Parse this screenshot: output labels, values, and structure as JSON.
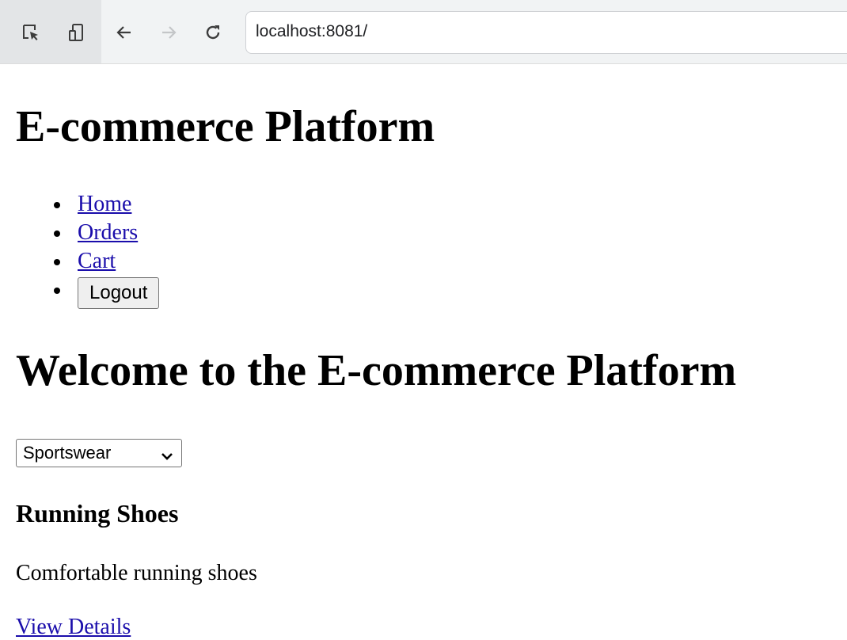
{
  "browser": {
    "url": "localhost:8081/",
    "icons": [
      "inspect-element-icon",
      "device-toggle-icon",
      "back-arrow-icon",
      "forward-arrow-icon",
      "reload-icon"
    ]
  },
  "header": {
    "title": "E-commerce Platform"
  },
  "nav": {
    "items": [
      {
        "label": "Home"
      },
      {
        "label": "Orders"
      },
      {
        "label": "Cart"
      }
    ],
    "logout_label": "Logout"
  },
  "main": {
    "heading": "Welcome to the E-commerce Platform",
    "category_select": {
      "selected": "Sportswear"
    },
    "products": [
      {
        "name": "Running Shoes",
        "description": "Comfortable running shoes",
        "link_label": "View Details"
      }
    ]
  },
  "colors": {
    "link": "#1a0dab",
    "toolbar_bg": "#f1f3f4"
  }
}
